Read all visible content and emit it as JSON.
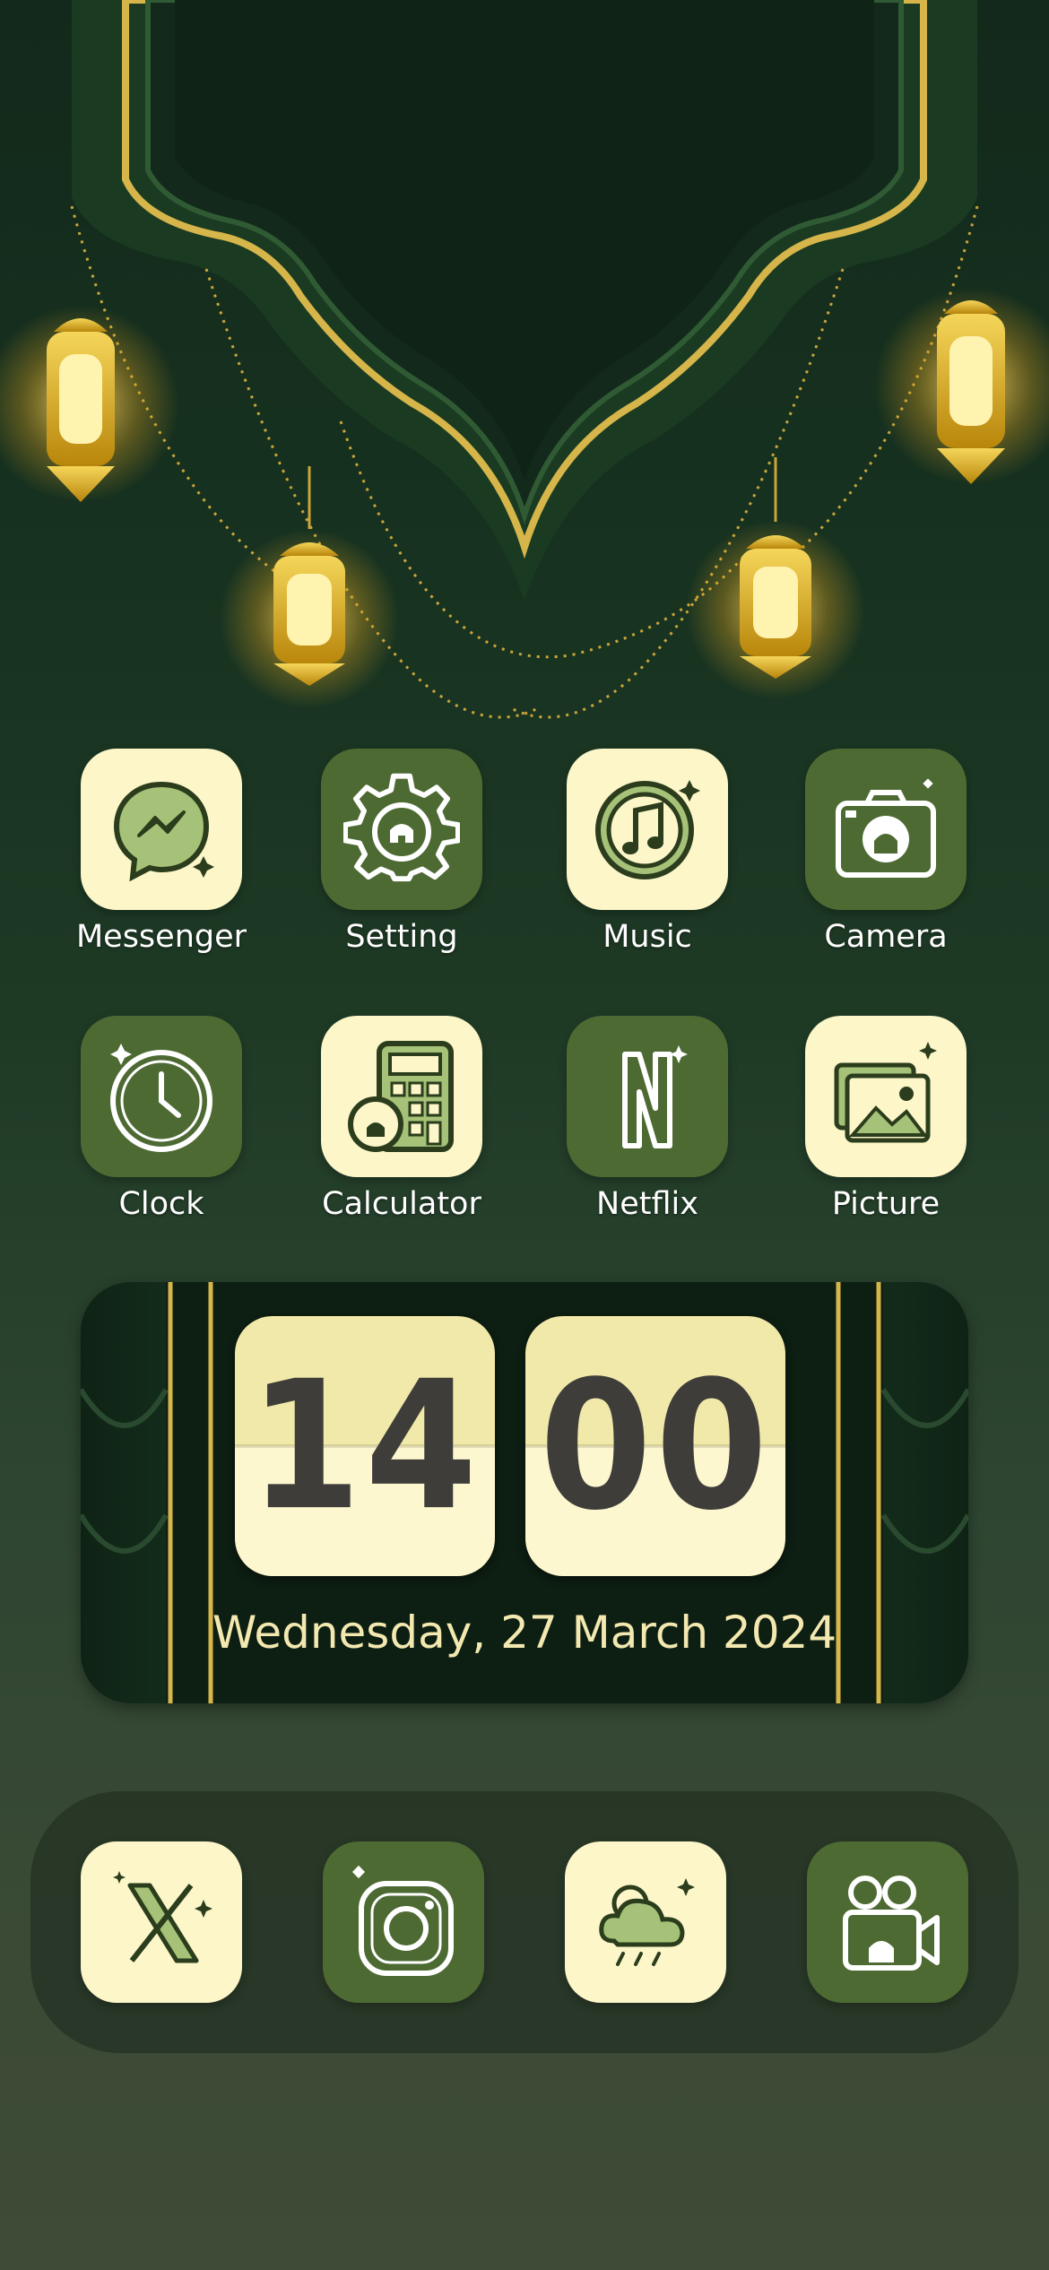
{
  "row1": [
    {
      "label": "Messenger",
      "icon": "messenger-icon"
    },
    {
      "label": "Setting",
      "icon": "gear-icon"
    },
    {
      "label": "Music",
      "icon": "music-note-icon"
    },
    {
      "label": "Camera",
      "icon": "camera-icon"
    }
  ],
  "row2": [
    {
      "label": "Clock",
      "icon": "clock-icon"
    },
    {
      "label": "Calculator",
      "icon": "calculator-icon"
    },
    {
      "label": "Netflix",
      "icon": "netflix-icon"
    },
    {
      "label": "Picture",
      "icon": "picture-icon"
    }
  ],
  "widget": {
    "hours": "14",
    "minutes": "00",
    "date": "Wednesday, 27 March 2024"
  },
  "dock": [
    {
      "icon": "x-icon"
    },
    {
      "icon": "instagram-icon"
    },
    {
      "icon": "weather-icon"
    },
    {
      "icon": "video-camera-icon"
    }
  ],
  "colors": {
    "cream": "#fcf6c9",
    "green": "#4d6a33",
    "gold": "#d6b54a",
    "background": "#173220"
  }
}
